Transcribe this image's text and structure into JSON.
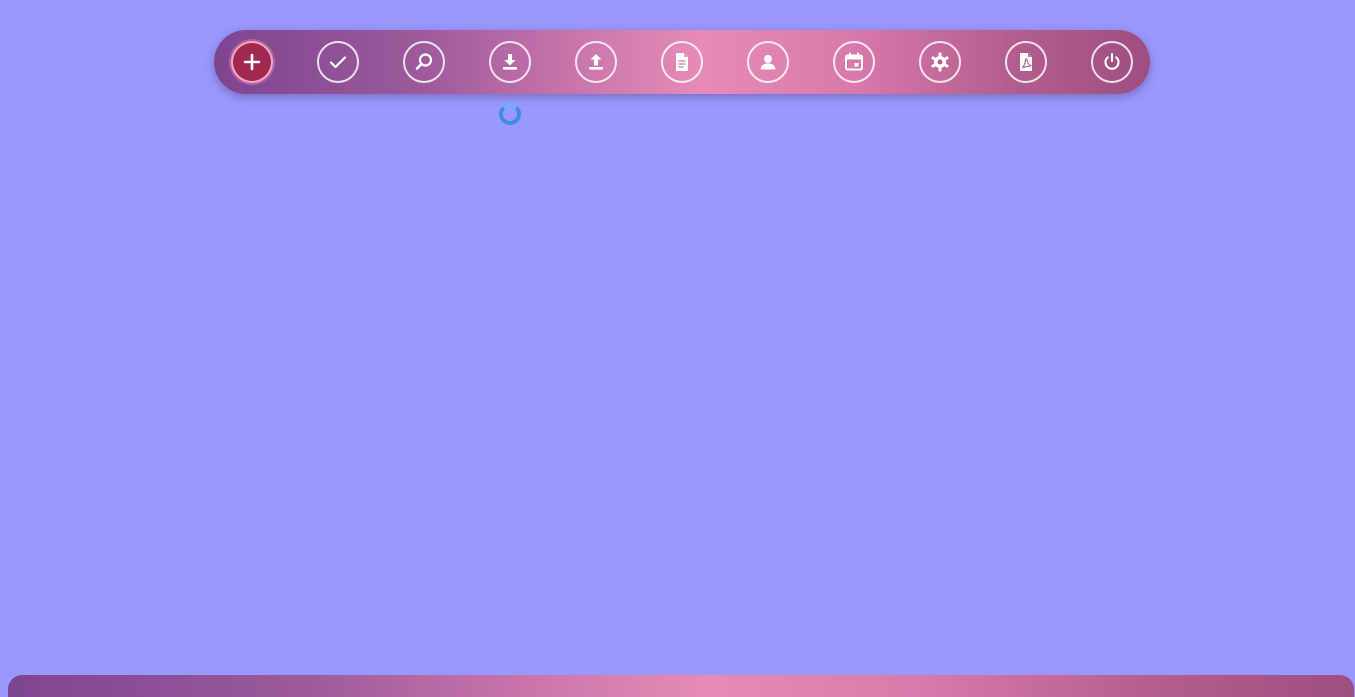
{
  "colors": {
    "background": "#9999fd",
    "toolbar_gradient": [
      "#7e4590",
      "#c874ab",
      "#e68bb6",
      "#b45e8e",
      "#9e4e80"
    ],
    "active_button": "#a1284f",
    "spinner": "#3b8de6"
  },
  "toolbar": {
    "buttons": [
      {
        "icon": "plus-icon",
        "active": true
      },
      {
        "icon": "check-icon",
        "active": false
      },
      {
        "icon": "search-icon",
        "active": false
      },
      {
        "icon": "download-icon",
        "active": false
      },
      {
        "icon": "upload-icon",
        "active": false
      },
      {
        "icon": "document-icon",
        "active": false
      },
      {
        "icon": "user-icon",
        "active": false
      },
      {
        "icon": "calendar-icon",
        "active": false
      },
      {
        "icon": "gear-icon",
        "active": false
      },
      {
        "icon": "pdf-file-icon",
        "active": false
      },
      {
        "icon": "power-icon",
        "active": false
      }
    ]
  },
  "loading": {
    "visible": true,
    "icon": "loading-spinner-icon"
  }
}
